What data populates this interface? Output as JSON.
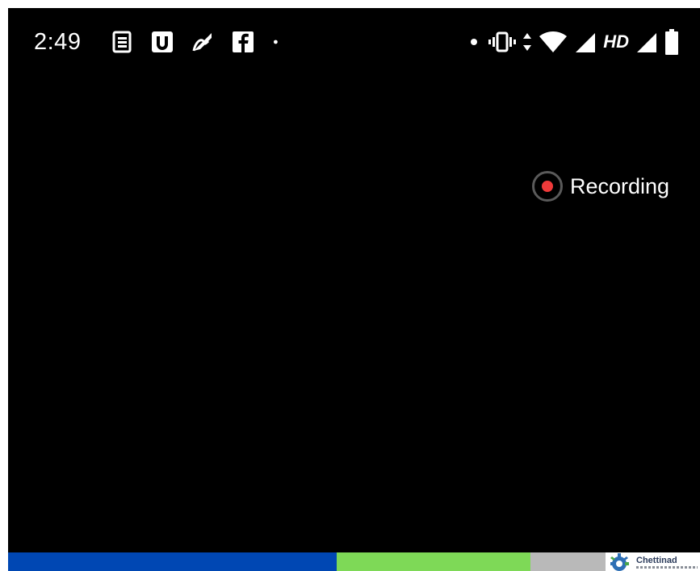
{
  "status_bar": {
    "time": "2:49",
    "notification_icons": [
      "news-icon",
      "u-app-icon",
      "swipe-app-icon",
      "facebook-icon",
      "dot-icon"
    ],
    "system_icons": [
      "dot-icon",
      "vibrate-icon",
      "data-arrows-icon",
      "wifi-icon",
      "signal-icon",
      "signal-icon",
      "battery-icon"
    ],
    "network_label": "HD"
  },
  "recording": {
    "label": "Recording",
    "dot_color": "#f03a3a"
  },
  "bottom_strip": {
    "colors": {
      "blue": "#0047b3",
      "green": "#7ed957",
      "gray": "#b9b9b9"
    },
    "logo_text": "Chettinad"
  },
  "colors": {
    "background": "#000000",
    "text": "#ffffff"
  }
}
